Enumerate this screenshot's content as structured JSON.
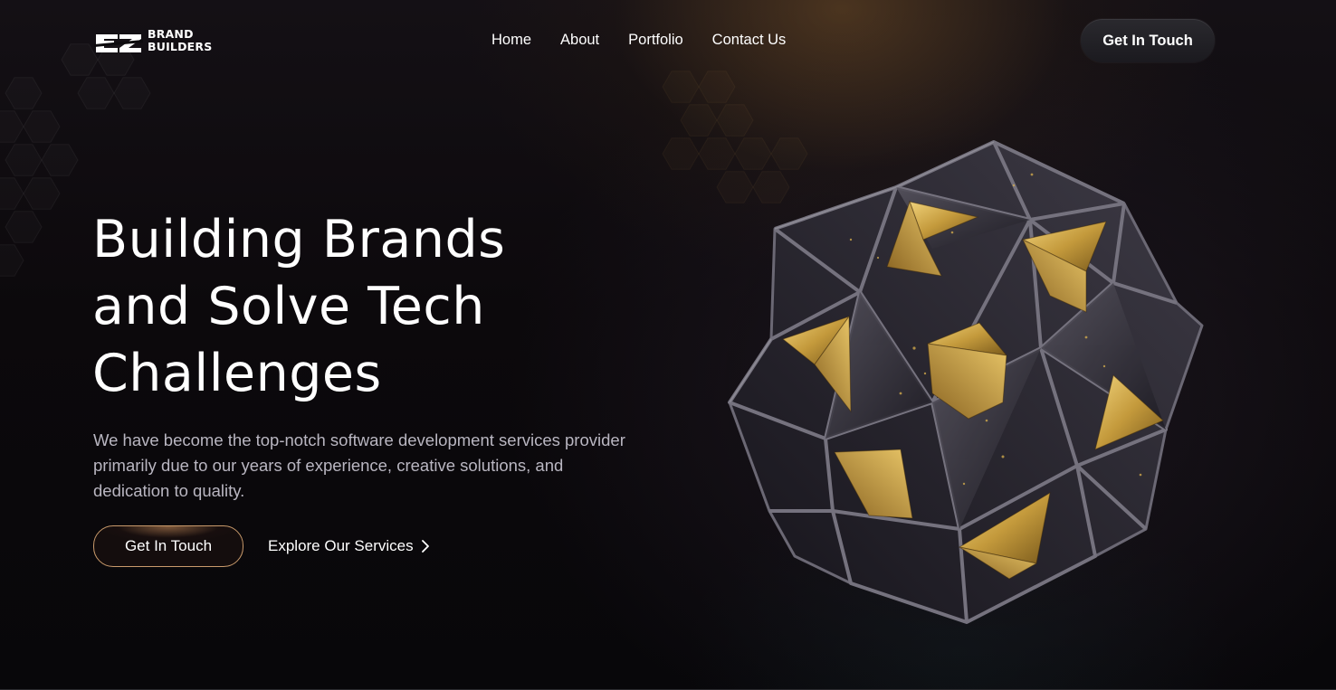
{
  "brand": {
    "logo_mark": "EZ",
    "logo_line1": "BRAND",
    "logo_line2": "BUILDERS"
  },
  "nav": {
    "items": [
      {
        "label": "Home"
      },
      {
        "label": "About"
      },
      {
        "label": "Portfolio"
      },
      {
        "label": "Contact Us"
      }
    ]
  },
  "header": {
    "cta_label": "Get In Touch"
  },
  "hero": {
    "title_line1": "Building Brands",
    "title_line2": "and Solve Tech",
    "title_line3": "Challenges",
    "description": "We have become the top-notch software development services provider primarily due to our years of experience, creative solutions, and dedication to quality.",
    "primary_button": "Get In Touch",
    "secondary_link": "Explore Our Services"
  },
  "icons": {
    "secondary_link_icon": "chevron-right-icon",
    "hero_art": "geometric-polyhedron-image"
  },
  "colors": {
    "background": "#0a080b",
    "accent_gold": "#c9a24a",
    "button_border": "#c99a6b",
    "body_text": "#b9b6c1"
  }
}
